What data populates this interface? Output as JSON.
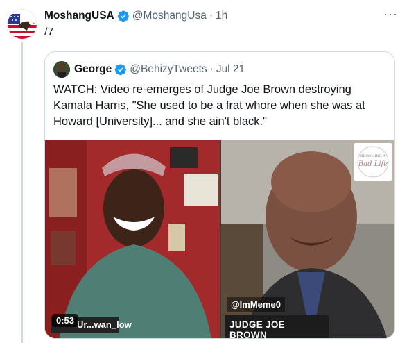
{
  "post": {
    "author_name": "MoshangUSA",
    "author_handle": "@MoshangUsa",
    "time": "1h",
    "text": "/7",
    "more_icon": "more-dots-icon"
  },
  "quoted": {
    "author_name": "George",
    "author_handle": "@BehizyTweets",
    "date": "Jul 21",
    "text": "WATCH: Video re-emerges of Judge Joe Brown destroying Kamala Harris, \"She used to be a frat whore when she was at Howard [University]... and she ain't black.\"",
    "video": {
      "duration": "0:53",
      "left_caption": "Ur...wan_low",
      "right_tag": "@ImMeme0",
      "right_name": "JUDGE JOE BROWN",
      "logo_text": "Becoming a Bad Life"
    }
  },
  "colors": {
    "verified_blue": "#1d9bf0",
    "muted": "#536471",
    "border": "#cfd9de"
  }
}
